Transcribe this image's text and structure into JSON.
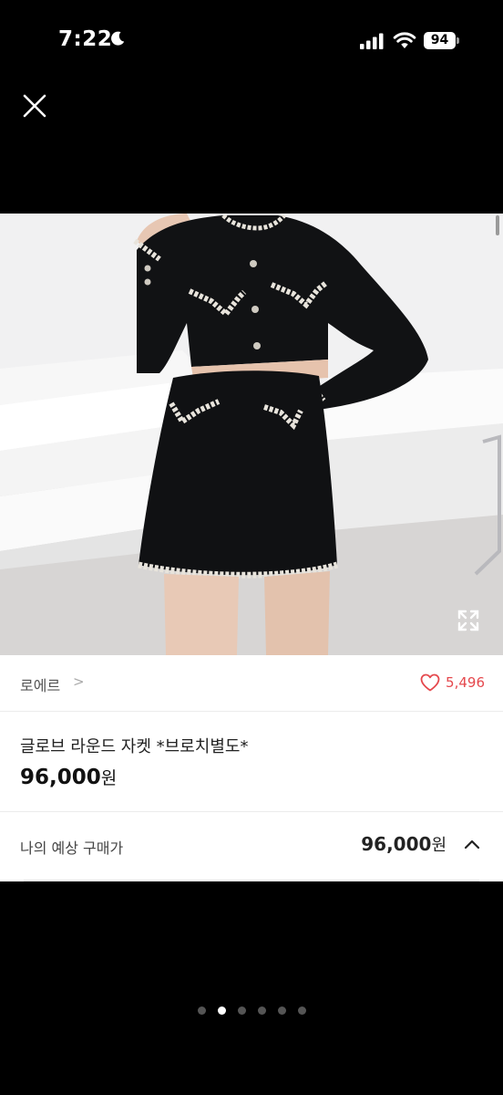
{
  "status_bar": {
    "time": "7:22",
    "battery": "94"
  },
  "icons": {
    "close": "close-icon",
    "moon": "moon-icon",
    "signal": "signal-icon",
    "wifi": "wifi-icon",
    "expand": "expand-icon",
    "heart": "heart-icon",
    "chevron_right": "chevron-right-icon",
    "chevron_up": "chevron-up-icon"
  },
  "shop": {
    "name": "로에르",
    "chevron": ">"
  },
  "likes": {
    "count": "5,496",
    "color": "#e5484d"
  },
  "product": {
    "title": "글로브 라운드 자켓 *브로치별도*",
    "price": "96,000",
    "price_unit": "원"
  },
  "estimate": {
    "label": "나의 예상 구매가",
    "price": "96,000",
    "unit": "원"
  },
  "pager": {
    "total": 6,
    "active_index": 1
  }
}
